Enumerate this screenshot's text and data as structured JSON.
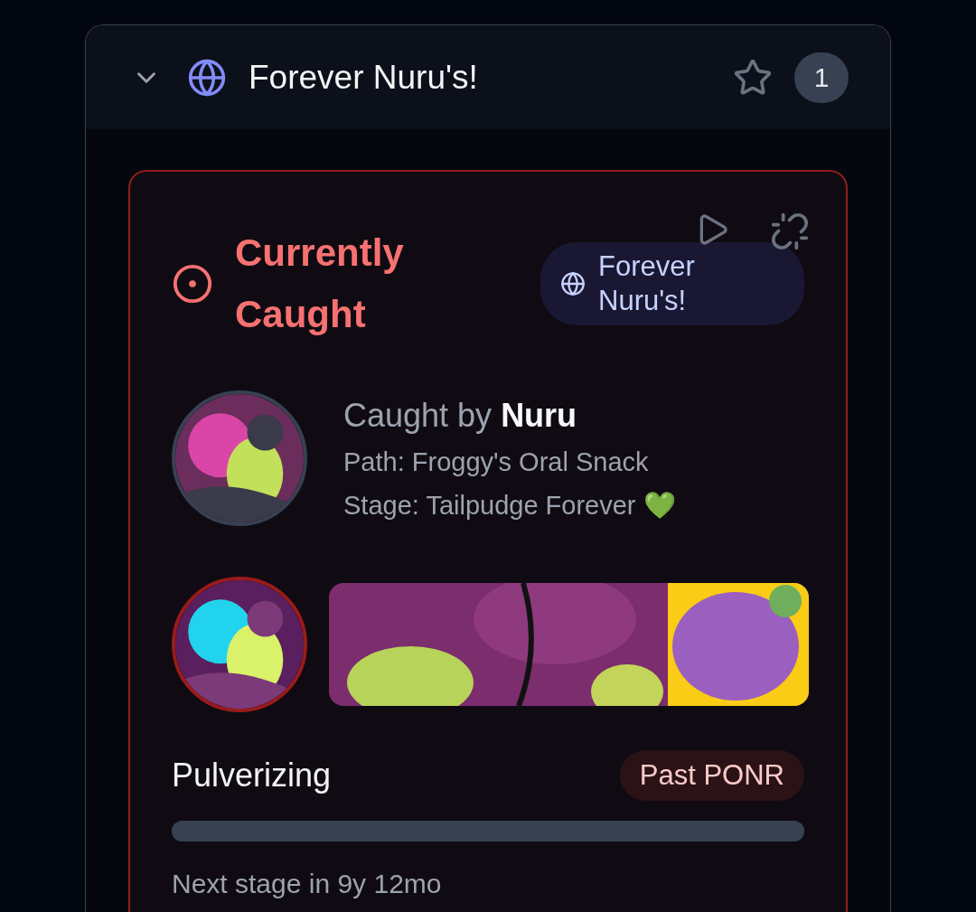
{
  "panel": {
    "title": "Forever Nuru's!",
    "expanded": true,
    "favorite": false,
    "count": "1"
  },
  "capture": {
    "status": "Currently Caught",
    "location": "Forever Nuru's!",
    "caught_by": "Caught by **Nuru**",
    "path": "Path: Froggy's Oral Snack",
    "stage": "Stage: Tailpudge Forever 💚",
    "phase": "Pulverizing",
    "badge": "Past PONR",
    "level": 0,
    "next": "Next stage in 9y 12mo"
  }
}
